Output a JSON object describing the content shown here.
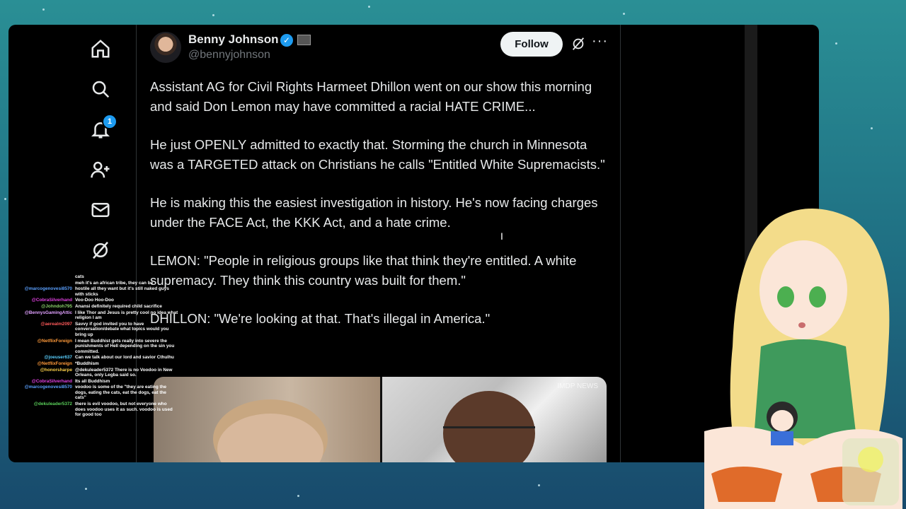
{
  "post": {
    "author_name": "Benny Johnson",
    "author_handle": "@bennyjohnson",
    "follow_label": "Follow",
    "more_label": "···",
    "paragraphs": [
      "Assistant AG for Civil Rights Harmeet Dhillon went on our show this morning and said Don Lemon may have committed a racial HATE CRIME...",
      "He just OPENLY admitted to exactly that. Storming the church in Minnesota was a TARGETED attack on Christians he calls \"Entitled White Supremacists.\"",
      "He is making this the easiest investigation in history. He's now facing charges under the FACE Act, the KKK Act, and a hate crime.",
      "LEMON: \"People in religious groups like that think they're entitled. A white supremacy. They think this country was built for them.\"",
      "DHILLON: \"We're looking at that. That's illegal in America.\""
    ],
    "media_watermark": "IMDP NEWS"
  },
  "nav": {
    "notification_count": "1",
    "icons": [
      "home-icon",
      "search-icon",
      "bell-icon",
      "add-person-icon",
      "mail-icon",
      "grok-icon"
    ]
  },
  "chat": [
    {
      "user": "",
      "msg": "cats",
      "color": "#ffffff"
    },
    {
      "user": "",
      "msg": "meh it's an african tribe, they can be",
      "color": "#ffffff"
    },
    {
      "user": "@marcogenovesi8570",
      "msg": "hostile all they want but it's still naked guys with sticks",
      "color": "#5aa0ff"
    },
    {
      "user": "@CobraSilverhand",
      "msg": "Voo-Doo Hoo-Doo",
      "color": "#e040e0"
    },
    {
      "user": "@Johndoh795",
      "msg": "Anansi definitely required child sacrifice",
      "color": "#8ad06a"
    },
    {
      "user": "@BennysGamingAttic",
      "msg": "I like Thor and Jesus is pretty cool no idea what religion I am",
      "color": "#e0a0ff"
    },
    {
      "user": "@aerealm2097",
      "msg": "Savvy if god invited you to have conversation/debate what topics would you bring up",
      "color": "#ff5a5a"
    },
    {
      "user": "@NetflixForeign",
      "msg": "I mean Buddhist gets really into severe the punishments of Hell depending on the sin you committed.",
      "color": "#ff9a3a"
    },
    {
      "user": "@joeuser637",
      "msg": "Can we talk about our lord and savior Cthulhu",
      "color": "#5ad0ff"
    },
    {
      "user": "@NetflixForeign",
      "msg": "*Buddhism",
      "color": "#ff9a3a"
    },
    {
      "user": "@honorsharpe",
      "msg": "@dekuleader5372 There is no Voodoo in New Orleans, only Legba said so.",
      "color": "#ffd24a"
    },
    {
      "user": "@CobraSilverhand",
      "msg": "Its all Buddhism",
      "color": "#e040e0"
    },
    {
      "user": "@marcogenovesi8570",
      "msg": "voodoo is some of the \"they are eating the dogs, eating the cats, eat the dogs, eat the cats\"",
      "color": "#5aa0ff"
    },
    {
      "user": "@dekuleader5372",
      "msg": "there is evil voodoo, but not everyone who does voodoo uses it as such. voodoo is used for good too",
      "color": "#5ad05a"
    }
  ]
}
